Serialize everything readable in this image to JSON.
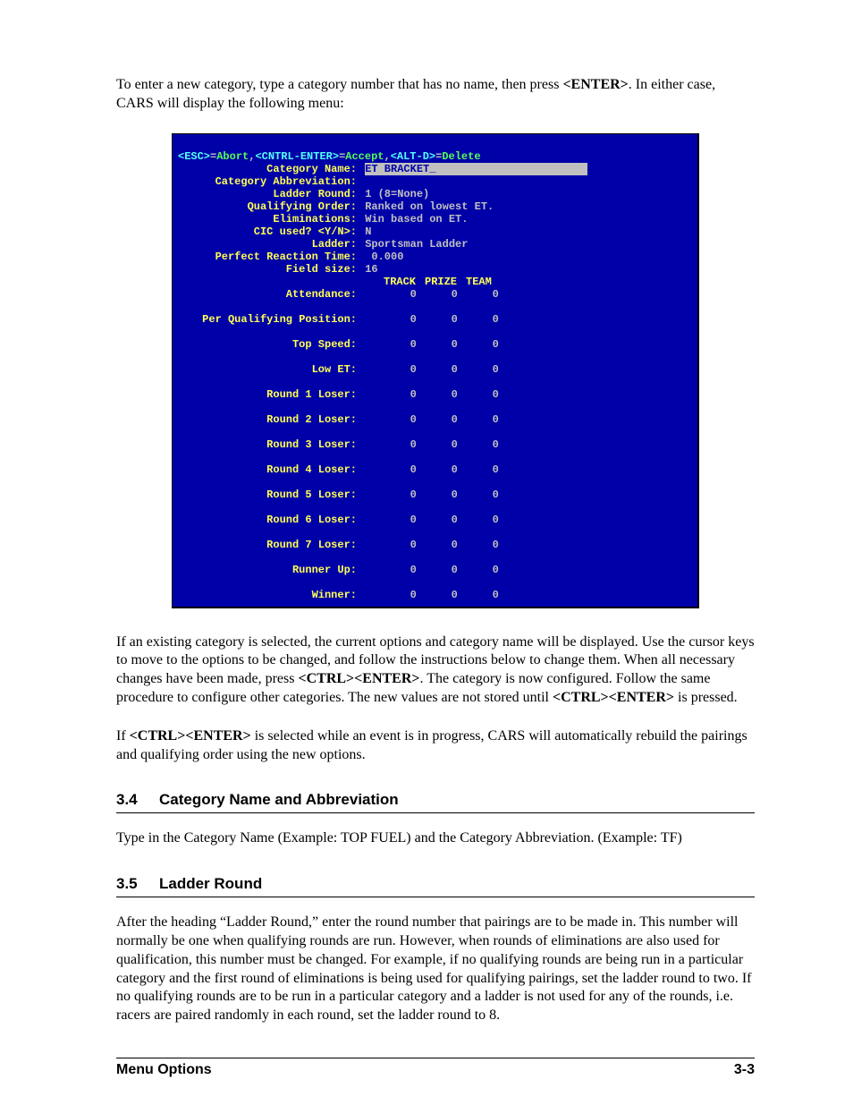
{
  "intro": {
    "before": "To enter a new category, type a category number that has no name, then press ",
    "key": "<ENTER>",
    "after": ". In either case, CARS will display the following menu:"
  },
  "term": {
    "menu": {
      "esc_key": "<ESC>",
      "esc_eq": "=",
      "esc_act": "Abort",
      "sep1": ",",
      "ce_key": "<CNTRL-ENTER>",
      "ce_eq": "=",
      "ce_act": "Accept",
      "sep2": ",",
      "ad_key": "<ALT-D>",
      "ad_eq": "=",
      "ad_act": "Delete"
    },
    "fields": {
      "category_name_lbl": "Category Name:",
      "category_name_val": "ET BRACKET_",
      "cat_abbr_lbl": "Category Abbreviation:",
      "cat_abbr_val": "",
      "ladder_round_lbl": "Ladder Round:",
      "ladder_round_val": "1 (8=None)",
      "qual_order_lbl": "Qualifying Order:",
      "qual_order_val": "Ranked on lowest ET.",
      "elim_lbl": "Eliminations:",
      "elim_val": "Win based on ET.",
      "cic_lbl": "CIC used? <Y/N>:",
      "cic_val": "N",
      "ladder_lbl": "Ladder:",
      "ladder_val": "Sportsman Ladder",
      "prt_lbl": "Perfect Reaction Time:",
      "prt_val": " 0.000",
      "field_size_lbl": "Field size:",
      "field_size_val": "16"
    },
    "columns": {
      "track": "TRACK",
      "prize": "PRIZE",
      "team": "TEAM"
    },
    "rows": [
      {
        "label": "Attendance:",
        "track": "0",
        "prize": "0",
        "team": "0"
      },
      {
        "label": "Per Qualifying Position:",
        "track": "0",
        "prize": "0",
        "team": "0"
      },
      {
        "label": "Top Speed:",
        "track": "0",
        "prize": "0",
        "team": "0"
      },
      {
        "label": "Low ET:",
        "track": "0",
        "prize": "0",
        "team": "0"
      },
      {
        "label": "Round 1 Loser:",
        "track": "0",
        "prize": "0",
        "team": "0"
      },
      {
        "label": "Round 2 Loser:",
        "track": "0",
        "prize": "0",
        "team": "0"
      },
      {
        "label": "Round 3 Loser:",
        "track": "0",
        "prize": "0",
        "team": "0"
      },
      {
        "label": "Round 4 Loser:",
        "track": "0",
        "prize": "0",
        "team": "0"
      },
      {
        "label": "Round 5 Loser:",
        "track": "0",
        "prize": "0",
        "team": "0"
      },
      {
        "label": "Round 6 Loser:",
        "track": "0",
        "prize": "0",
        "team": "0"
      },
      {
        "label": "Round 7 Loser:",
        "track": "0",
        "prize": "0",
        "team": "0"
      },
      {
        "label": "Runner Up:",
        "track": "0",
        "prize": "0",
        "team": "0"
      },
      {
        "label": "Winner:",
        "track": "0",
        "prize": "0",
        "team": "0"
      }
    ]
  },
  "p2": {
    "a": "If an existing category is selected, the current options and category name will be displayed. Use the cursor keys to move to the options to be changed, and follow the instructions below to change them. When all necessary changes have been made, press ",
    "k1": "<CTRL><ENTER>",
    "b": ". The category is now configured. Follow the same procedure to configure other categories. The new values are not stored until ",
    "k2": "<CTRL><ENTER>",
    "c": " is pressed."
  },
  "p3": {
    "a": "If ",
    "k1": "<CTRL><ENTER>",
    "b": " is selected while an event is in progress, CARS will automatically rebuild the pairings and qualifying order using the new options."
  },
  "sec34": {
    "num": "3.4",
    "title": "Category Name and Abbreviation"
  },
  "p34": "Type in the Category Name (Example: TOP FUEL) and the Category Abbreviation. (Example: TF)",
  "sec35": {
    "num": "3.5",
    "title": "Ladder Round"
  },
  "p35": "After the heading “Ladder Round,” enter the round number that pairings are to be made in. This number will normally be one when qualifying rounds are run. However, when rounds of eliminations are also used for qualification, this number must be changed. For example, if no qualifying rounds are being run in a particular category and the first round of eliminations is being used for qualifying pairings, set the ladder round to two. If no qualifying rounds are to be run in a particular category and a ladder is not used for any of the rounds, i.e. racers are paired randomly in each round, set the ladder round to 8.",
  "footer": {
    "left": "Menu Options",
    "right": "3-3"
  }
}
